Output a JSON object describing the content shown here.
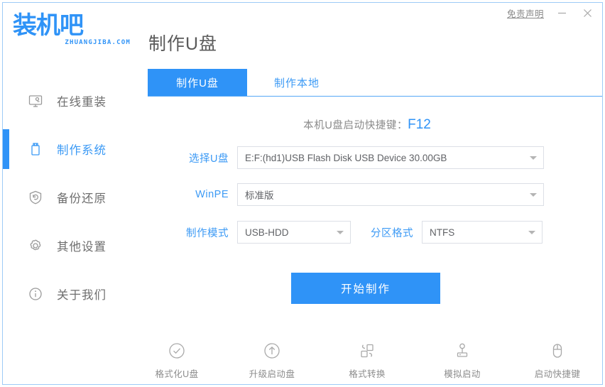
{
  "window": {
    "disclaimer_label": "免责声明",
    "minimize_label": "—",
    "close_label": "×"
  },
  "brand": {
    "logo_text": "装机吧",
    "logo_domain": "ZHUANGJIBA.COM"
  },
  "header": {
    "page_title": "制作U盘"
  },
  "sidebar": {
    "items": [
      {
        "label": "在线重装",
        "icon": "monitor-icon",
        "active": false
      },
      {
        "label": "制作系统",
        "icon": "usb-drive-icon",
        "active": true
      },
      {
        "label": "备份还原",
        "icon": "shield-restore-icon",
        "active": false
      },
      {
        "label": "其他设置",
        "icon": "gear-icon",
        "active": false
      },
      {
        "label": "关于我们",
        "icon": "info-icon",
        "active": false
      }
    ]
  },
  "main": {
    "tabs": [
      {
        "label": "制作U盘",
        "active": true
      },
      {
        "label": "制作本地",
        "active": false
      }
    ],
    "hotkey_prefix": "本机U盘启动快捷键：",
    "hotkey_value": "F12",
    "fields": {
      "usb": {
        "label": "选择U盘",
        "value": "E:F:(hd1)USB Flash Disk USB Device 30.00GB"
      },
      "winpe": {
        "label": "WinPE",
        "value": "标准版"
      },
      "mode": {
        "label": "制作模式",
        "value": "USB-HDD"
      },
      "format": {
        "label": "分区格式",
        "value": "NTFS"
      }
    },
    "start_button": "开始制作"
  },
  "toolbar": {
    "items": [
      {
        "label": "格式化U盘",
        "icon": "check-circle-icon"
      },
      {
        "label": "升级启动盘",
        "icon": "arrow-up-circle-icon"
      },
      {
        "label": "格式转换",
        "icon": "convert-shapes-icon"
      },
      {
        "label": "模拟启动",
        "icon": "joystick-icon"
      },
      {
        "label": "启动快捷键",
        "icon": "mouse-icon"
      }
    ]
  },
  "colors": {
    "accent": "#2f93f7",
    "accent_light": "#3c9af5",
    "border": "#9ecbf7",
    "text_gray": "#6e6e6e"
  }
}
